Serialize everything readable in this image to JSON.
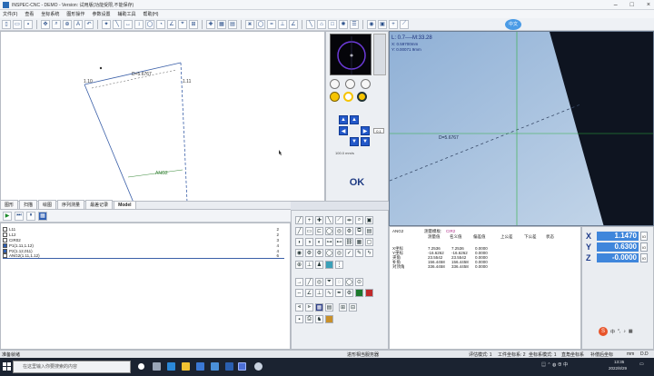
{
  "window": {
    "title": "INSPEC-CNC - DEMO - Version: 试用版(功能受限,不能保存)"
  },
  "menu": [
    "文件(F)",
    "查看",
    "坐标系统",
    "图形操作",
    "参数设置",
    "辅助工具",
    "帮助(H)"
  ],
  "canvas": {
    "point_label_a": "1.10",
    "point_label_b": "1.11",
    "distance_label": "D=5.6767",
    "angle_label": "ANG2"
  },
  "camera": {
    "ui_badge": "中文",
    "info_line1": "L: 0.7----M:33.28",
    "info_line2": "X: 0.59700mm",
    "info_line3": "Y: 0.00071 9mm",
    "line_label": "D=5.6767"
  },
  "midpanel": {
    "ok_label": "OK",
    "step_value": "0.1",
    "step_unit": "100.0  mm/s"
  },
  "tabs": [
    "图形",
    "扫描",
    "绘图",
    "序列测量",
    "最差记录",
    "Model"
  ],
  "feature_list": [
    {
      "name": "L11",
      "count": "2"
    },
    {
      "name": "L12",
      "count": "2"
    },
    {
      "name": "CIR02",
      "count": "3"
    },
    {
      "name": "P1(1.11,1.12)",
      "count": "4"
    },
    {
      "name": "P2(1.12,011)",
      "count": "4"
    },
    {
      "name": "ANG2(1.11,1.12)",
      "count": "6"
    }
  ],
  "results": {
    "feature": "ANG2",
    "columns": [
      "",
      "测量值",
      "名义值",
      "偏差值",
      "上公差",
      "下公差",
      "状态"
    ],
    "selected_label": "测量模板:",
    "selected_value": "CIR2",
    "rows": [
      {
        "name": "X坐标",
        "meas": "7.2536",
        "nom": "7.2536",
        "dev": "0.0000"
      },
      {
        "name": "Y坐标",
        "meas": "-16.6262",
        "nom": "-16.6262",
        "dev": "0.0000"
      },
      {
        "name": "夹角",
        "meas": "23.5542",
        "nom": "23.5542",
        "dev": "0.0000"
      },
      {
        "name": "补角",
        "meas": "156.4458",
        "nom": "156.4458",
        "dev": "0.0000"
      },
      {
        "name": "对顶角",
        "meas": "336.4458",
        "nom": "336.4458",
        "dev": "0.0000"
      }
    ]
  },
  "dro": [
    {
      "axis": "X",
      "value": "1.1470",
      "unit": "IO"
    },
    {
      "axis": "Y",
      "value": "0.6300",
      "unit": "IO"
    },
    {
      "axis": "Z",
      "value": "-0.0000",
      "unit": "IO"
    }
  ],
  "status": {
    "left": "准备就绪",
    "center": "进形相当服务器",
    "mode": "评估模式: 1",
    "coord": "工件坐标系: 2",
    "coord2": "坐标系模式: 1",
    "point_coord": "直角坐标系",
    "level": "补偿后坐标",
    "unit": "mm",
    "dd": "D.D"
  },
  "taskbar": {
    "search_placeholder": "在这里输入你要搜索的内容",
    "time": "13:35",
    "date": "2022/8/29",
    "ime": "中"
  }
}
